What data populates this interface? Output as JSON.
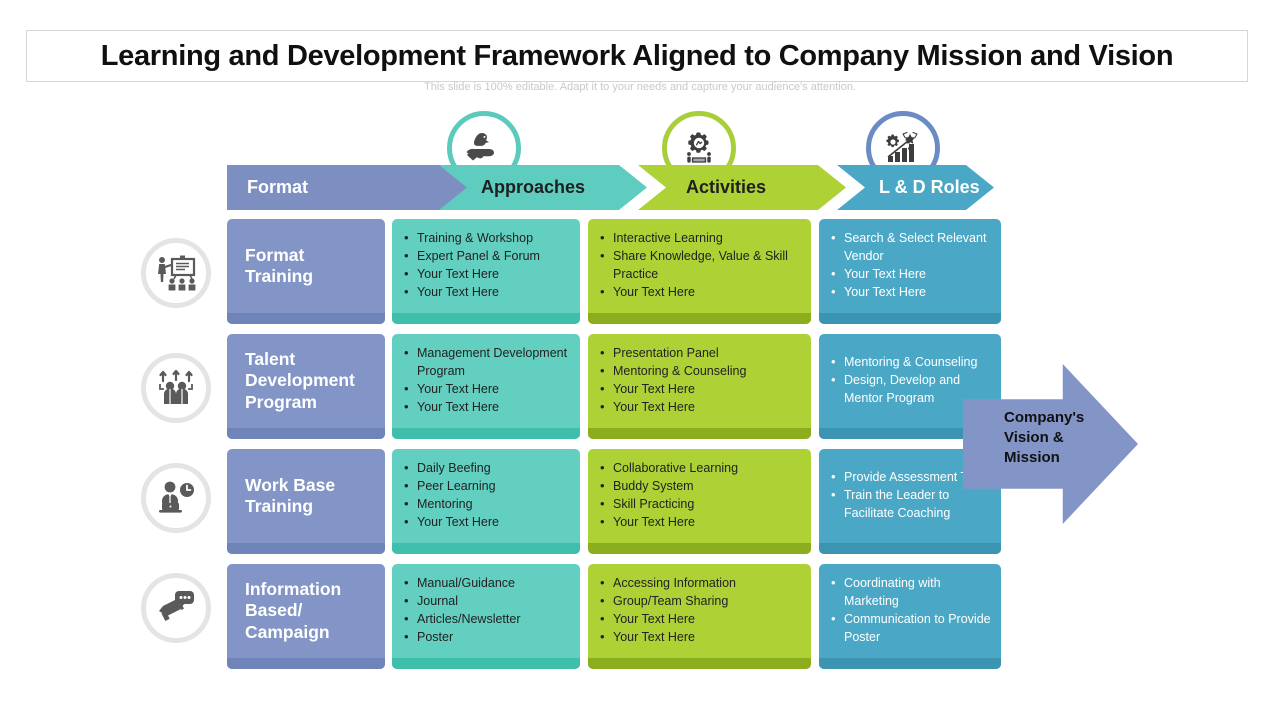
{
  "slide": {
    "title": "Learning and Development Framework Aligned to Company Mission and Vision",
    "subtitle": "This slide is 100% editable. Adapt it to your needs and capture your audience's attention."
  },
  "colors": {
    "format": "#8295c6",
    "approaches": "#63cfc0",
    "activities": "#aed136",
    "roles": "#4aa8c6",
    "title_text": "#101010",
    "subtitle_text": "#c9c9c9"
  },
  "headers": [
    {
      "label": "Format",
      "icon": ""
    },
    {
      "label": "Approaches",
      "icon": "hand-holding-bird-icon"
    },
    {
      "label": "Activities",
      "icon": "gear-people-icon"
    },
    {
      "label": "L & D Roles",
      "icon": "growth-chart-icon"
    }
  ],
  "rows": [
    {
      "icon": "presenter-whiteboard-audience-icon",
      "format": "Format\nTraining",
      "format_lines": [
        "Format",
        "Training"
      ],
      "approaches": [
        "Training & Workshop",
        "Expert Panel & Forum",
        "Your Text Here",
        "Your Text Here"
      ],
      "activities": [
        "Interactive Learning",
        "Share Knowledge, Value & Skill Practice",
        "Your Text Here"
      ],
      "roles": [
        "Search & Select Relevant Vendor",
        "Your Text Here",
        "Your Text Here"
      ]
    },
    {
      "icon": "people-growth-arrows-icon",
      "format": "Talent\nDevelopment\nProgram",
      "format_lines": [
        "Talent",
        "Development",
        "Program"
      ],
      "approaches": [
        "Management Development Program",
        "Your Text Here",
        "Your Text Here"
      ],
      "activities": [
        "Presentation Panel",
        "Mentoring & Counseling",
        "Your Text Here",
        "Your Text Here"
      ],
      "roles": [
        "Mentoring & Counseling",
        "Design, Develop and Mentor Program"
      ]
    },
    {
      "icon": "person-laptop-clock-icon",
      "format": "Work Base\nTraining",
      "format_lines": [
        "Work Base",
        "Training"
      ],
      "approaches": [
        "Daily Beefing",
        "Peer Learning",
        "Mentoring",
        "Your Text Here"
      ],
      "activities": [
        "Collaborative Learning",
        "Buddy System",
        "Skill Practicing",
        "Your Text Here"
      ],
      "roles": [
        "Provide Assessment Tools",
        "Train the Leader to Facilitate Coaching"
      ]
    },
    {
      "icon": "megaphone-speech-bubble-icon",
      "format": "Information\nBased/\nCampaign",
      "format_lines": [
        "Information",
        "Based/",
        "Campaign"
      ],
      "approaches": [
        "Manual/Guidance",
        "Journal",
        "Articles/Newsletter",
        "Poster"
      ],
      "activities": [
        "Accessing Information",
        "Group/Team Sharing",
        "Your Text Here",
        "Your Text Here"
      ],
      "roles": [
        "Coordinating with Marketing",
        "Communication to Provide Poster"
      ]
    }
  ],
  "outcome": {
    "label": "Company's Vision & Mission",
    "lines": [
      "Company's",
      "Vision &",
      "Mission"
    ]
  }
}
